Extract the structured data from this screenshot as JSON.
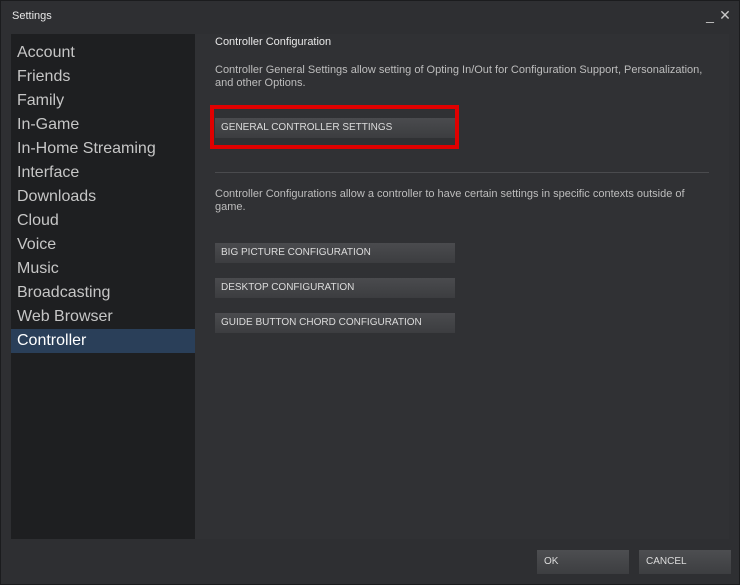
{
  "window": {
    "title": "Settings",
    "minimize_glyph": "_",
    "close_glyph": "✕"
  },
  "sidebar": {
    "items": [
      {
        "label": "Account"
      },
      {
        "label": "Friends"
      },
      {
        "label": "Family"
      },
      {
        "label": "In-Game"
      },
      {
        "label": "In-Home Streaming"
      },
      {
        "label": "Interface"
      },
      {
        "label": "Downloads"
      },
      {
        "label": "Cloud"
      },
      {
        "label": "Voice"
      },
      {
        "label": "Music"
      },
      {
        "label": "Broadcasting"
      },
      {
        "label": "Web Browser"
      },
      {
        "label": "Controller"
      }
    ],
    "selected": "Controller"
  },
  "main": {
    "heading": "Controller Configuration",
    "general_description": "Controller General Settings allow setting of Opting In/Out for Configuration Support, Personalization, and other Options.",
    "general_button": "GENERAL CONTROLLER SETTINGS",
    "configs_description": "Controller Configurations allow a controller to have certain settings in specific contexts outside of game.",
    "big_picture_button": "BIG PICTURE CONFIGURATION",
    "desktop_button": "DESKTOP CONFIGURATION",
    "guide_chord_button": "GUIDE BUTTON CHORD CONFIGURATION"
  },
  "footer": {
    "ok_label": "OK",
    "cancel_label": "CANCEL"
  },
  "colors": {
    "highlight_border": "#e00000",
    "selected_item_bg": "#2a3f59"
  }
}
